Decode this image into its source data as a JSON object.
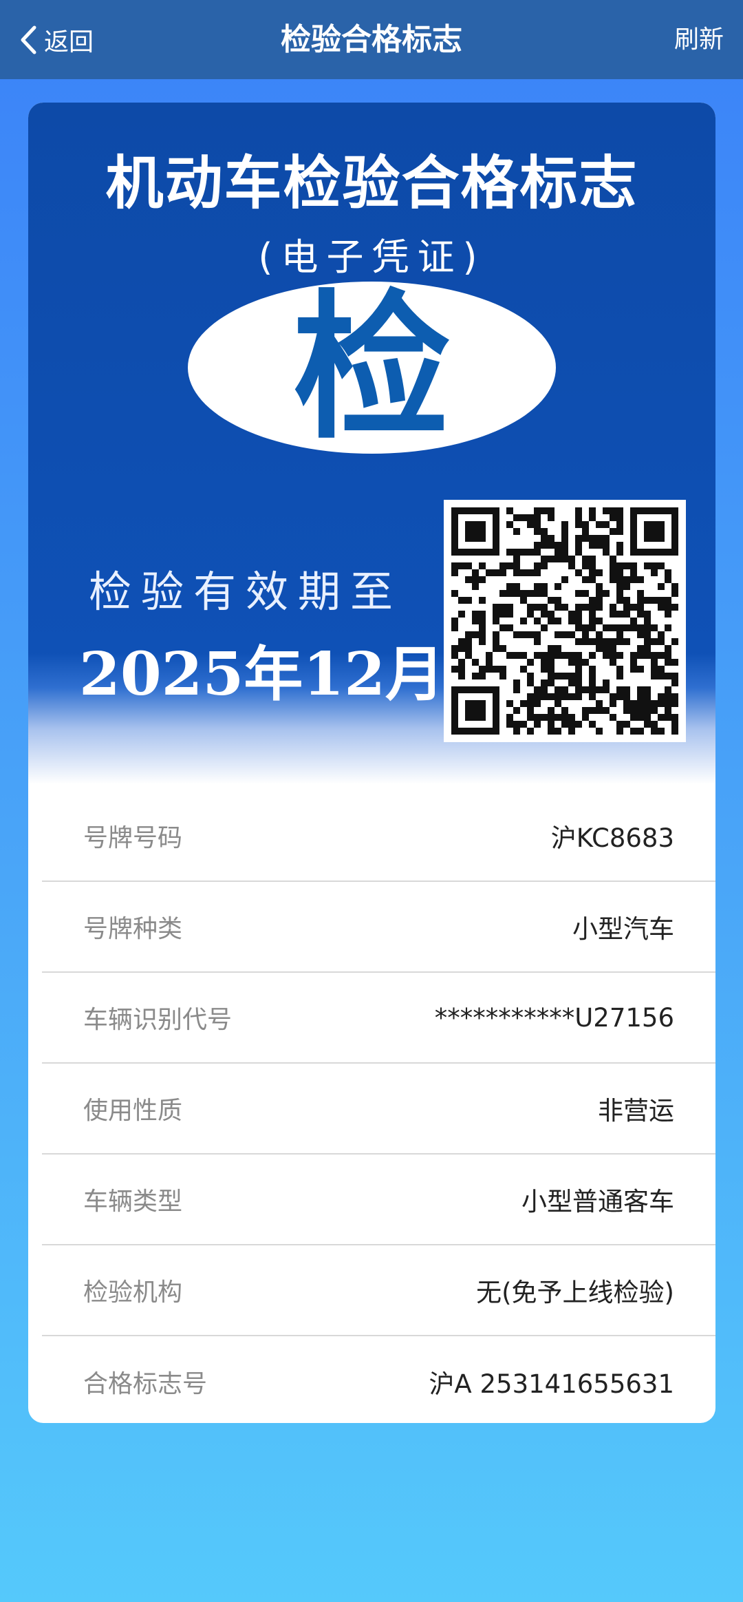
{
  "header": {
    "back_label": "返回",
    "title": "检验合格标志",
    "refresh_label": "刷新"
  },
  "card": {
    "title": "机动车检验合格标志",
    "subtitle": "(电子凭证)",
    "seal_char": "检",
    "valid_label": "检验有效期至",
    "valid_date": "2025年12月"
  },
  "fields": [
    {
      "label": "号牌号码",
      "value": "沪KC8683"
    },
    {
      "label": "号牌种类",
      "value": "小型汽车"
    },
    {
      "label": "车辆识别代号",
      "value": "***********U27156"
    },
    {
      "label": "使用性质",
      "value": "非营运"
    },
    {
      "label": "车辆类型",
      "value": "小型普通客车"
    },
    {
      "label": "检验机构",
      "value": "无(免予上线检验)"
    },
    {
      "label": "合格标志号",
      "value": "沪A 253141655631"
    }
  ],
  "colors": {
    "header_bg": "#2a63a9",
    "card_blue": "#0f51b6",
    "seal_text": "#0d5db0"
  }
}
